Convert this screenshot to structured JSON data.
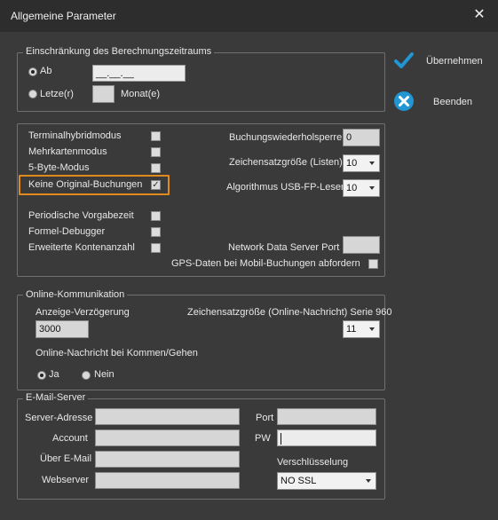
{
  "window": {
    "title": "Allgemeine Parameter",
    "close_glyph": "✕"
  },
  "actions": {
    "apply_label": "Übernehmen",
    "exit_label": "Beenden",
    "apply_color": "#2196d3",
    "exit_color": "#2196d3"
  },
  "period": {
    "legend": "Einschränkung des Berechnungszeitraums",
    "ab_label": "Ab",
    "ab_value": "__.__.__",
    "ab_selected": true,
    "letzte_label": "Letze(r)",
    "letzte_value": "",
    "monat_label": "Monat(e)"
  },
  "options": {
    "checkboxes": [
      {
        "label": "Terminalhybridmodus",
        "checked": false
      },
      {
        "label": "Mehrkartenmodus",
        "checked": false
      },
      {
        "label": "5-Byte-Modus",
        "checked": false
      },
      {
        "label": "Keine Original-Buchungen",
        "checked": true,
        "highlighted": true
      },
      {
        "label": "Periodische Vorgabezeit",
        "checked": false
      },
      {
        "label": "Formel-Debugger",
        "checked": false
      },
      {
        "label": "Erweiterte Kontenanzahl",
        "checked": false
      }
    ],
    "booking_repeat_label": "Buchungswiederholsperre",
    "booking_repeat_value": "0",
    "font_size_list_label": "Zeichensatzgröße (Listen)",
    "font_size_list_value": "10",
    "algo_usb_label": "Algorithmus USB-FP-Leser",
    "algo_usb_value": "10",
    "network_port_label": "Network Data Server Port",
    "network_port_value": "",
    "gps_label": "GPS-Daten bei Mobil-Buchungen abfordern",
    "gps_checked": false,
    "highlight_color": "#e08a1e"
  },
  "online": {
    "legend": "Online-Kommunikation",
    "delay_label": "Anzeige-Verzögerung",
    "delay_value": "3000",
    "font_size_label": "Zeichensatzgröße (Online-Nachricht) Serie 960",
    "font_size_value": "11",
    "message_label": "Online-Nachricht bei Kommen/Gehen",
    "ja_label": "Ja",
    "nein_label": "Nein",
    "ja_selected": true
  },
  "email": {
    "legend": "E-Mail-Server",
    "server_label": "Server-Adresse",
    "server_value": "",
    "port_label": "Port",
    "port_value": "",
    "account_label": "Account",
    "account_value": "",
    "pw_label": "PW",
    "pw_value": "",
    "via_label": "Über E-Mail",
    "via_value": "",
    "webserver_label": "Webserver",
    "webserver_value": "",
    "encryption_label": "Verschlüsselung",
    "encryption_value": "NO SSL"
  }
}
